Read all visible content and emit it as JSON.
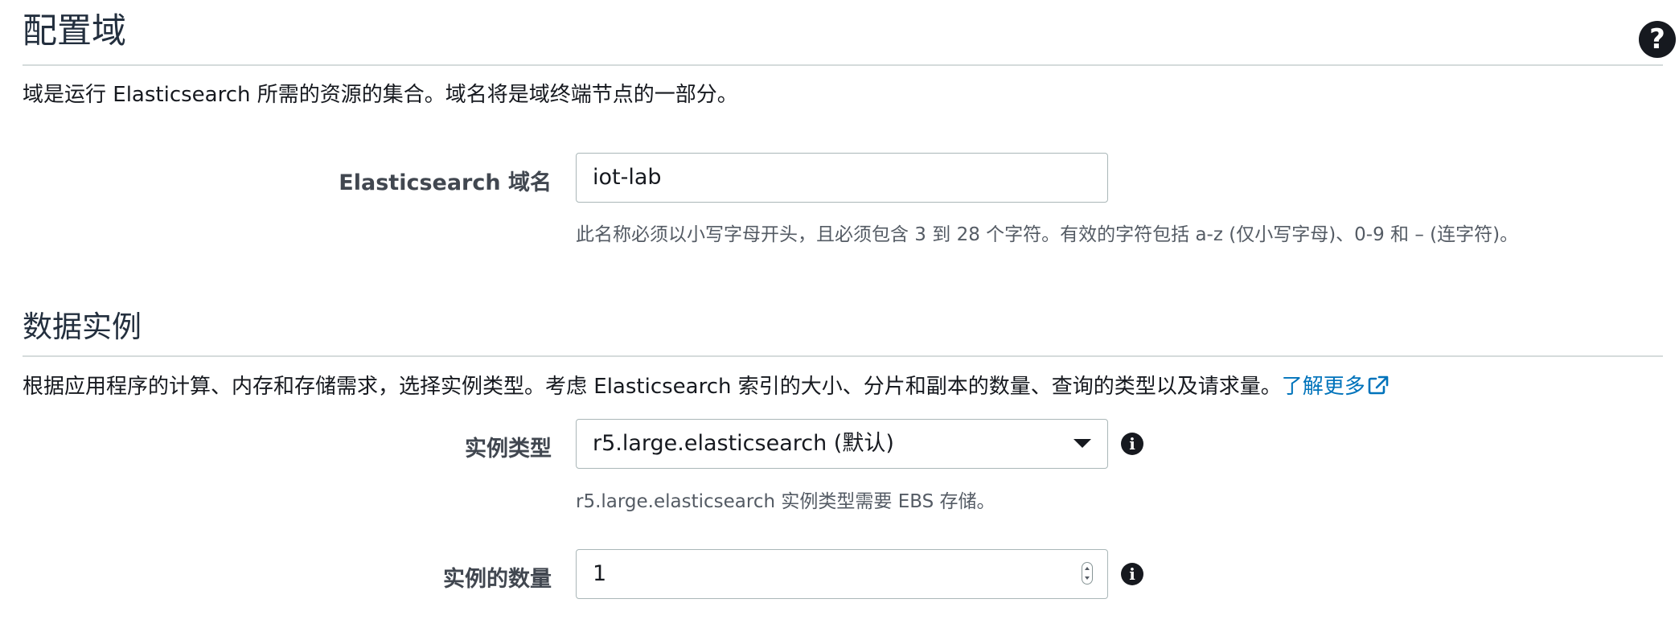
{
  "domain_section": {
    "title": "配置域",
    "description": "域是运行 Elasticsearch 所需的资源的集合。域名将是域终端节点的一部分。",
    "domain_name": {
      "label": "Elasticsearch 域名",
      "value": "iot-lab",
      "hint": "此名称必须以小写字母开头，且必须包含 3 到 28 个字符。有效的字符包括 a-z (仅小写字母)、0-9 和 – (连字符)。"
    },
    "help_icon": "?"
  },
  "data_instances": {
    "title": "数据实例",
    "description": "根据应用程序的计算、内存和存储需求，选择实例类型。考虑 Elasticsearch 索引的大小、分片和副本的数量、查询的类型以及请求量。",
    "learn_more": "了解更多",
    "instance_type": {
      "label": "实例类型",
      "value": "r5.large.elasticsearch (默认)",
      "hint": "r5.large.elasticsearch 实例类型需要 EBS 存储。"
    },
    "instance_count": {
      "label": "实例的数量",
      "value": "1"
    },
    "info_icon": "i"
  },
  "icons": {
    "help": "help-circle-icon",
    "info": "info-circle-icon",
    "external": "external-link-icon",
    "dropdown": "caret-down-icon"
  },
  "colors": {
    "link": "#0073bb",
    "text": "#16191f",
    "hint": "#545b64",
    "border": "#aab7b8",
    "divider": "#d5dbdb"
  }
}
